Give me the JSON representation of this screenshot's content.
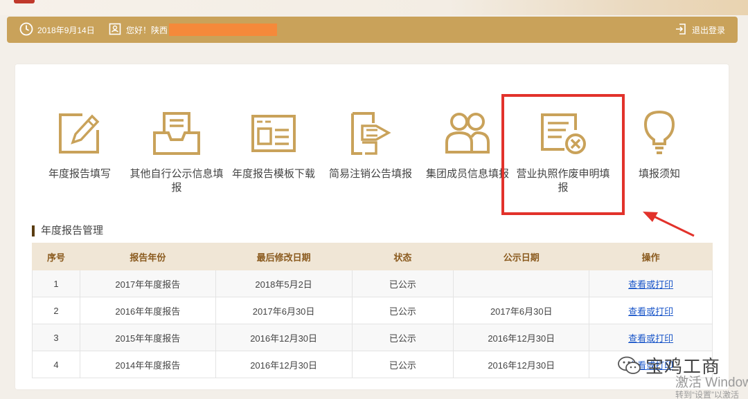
{
  "header": {
    "date": "2018年9月14日",
    "greeting": "您好！陕西",
    "logout": "退出登录"
  },
  "functions": [
    {
      "label": "年度报告填写",
      "icon": "edit-icon"
    },
    {
      "label": "其他自行公示信息填报",
      "icon": "inbox-tray-icon"
    },
    {
      "label": "年度报告模板下载",
      "icon": "template-form-icon"
    },
    {
      "label": "简易注销公告填报",
      "icon": "document-stamp-icon"
    },
    {
      "label": "集团成员信息填报",
      "icon": "group-users-icon"
    },
    {
      "label": "营业执照作废申明填报",
      "icon": "license-cancel-icon"
    },
    {
      "label": "填报须知",
      "icon": "lightbulb-icon"
    }
  ],
  "section_title": "年度报告管理",
  "table": {
    "headers": [
      "序号",
      "报告年份",
      "最后修改日期",
      "状态",
      "公示日期",
      "操作"
    ],
    "rows": [
      [
        "1",
        "2017年年度报告",
        "2018年5月2日",
        "已公示",
        "",
        "查看或打印"
      ],
      [
        "2",
        "2016年年度报告",
        "2017年6月30日",
        "已公示",
        "2017年6月30日",
        "查看或打印"
      ],
      [
        "3",
        "2015年年度报告",
        "2016年12月30日",
        "已公示",
        "2016年12月30日",
        "查看或打印"
      ],
      [
        "4",
        "2014年年度报告",
        "2016年12月30日",
        "已公示",
        "2016年12月30日",
        "查看或打印"
      ]
    ]
  },
  "watermark": {
    "wechat": "宝鸡工商",
    "activate_line1": "激活 Windows",
    "activate_line2": "转到“设置”以激活"
  },
  "colors": {
    "header_bg": "#c9a25a",
    "icon_gold": "#c9a25a",
    "highlight_red": "#e2322b",
    "link_blue": "#1a56c9",
    "table_head_bg": "#f0e6d6"
  }
}
